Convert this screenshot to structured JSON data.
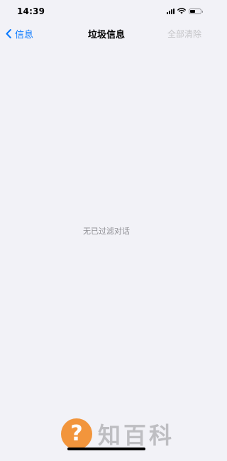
{
  "status_bar": {
    "time": "14:39",
    "battery_level": 0.5
  },
  "nav": {
    "back_label": "信息",
    "title": "垃圾信息",
    "clear_all_label": "全部清除"
  },
  "main": {
    "empty_message": "无已过滤对话"
  },
  "watermark": {
    "symbol": "?",
    "text": "知百科"
  },
  "colors": {
    "accent": "#0a7aff",
    "background": "#f2f2f7",
    "disabled": "#c4c4c7",
    "secondary_text": "#8e8e93"
  }
}
